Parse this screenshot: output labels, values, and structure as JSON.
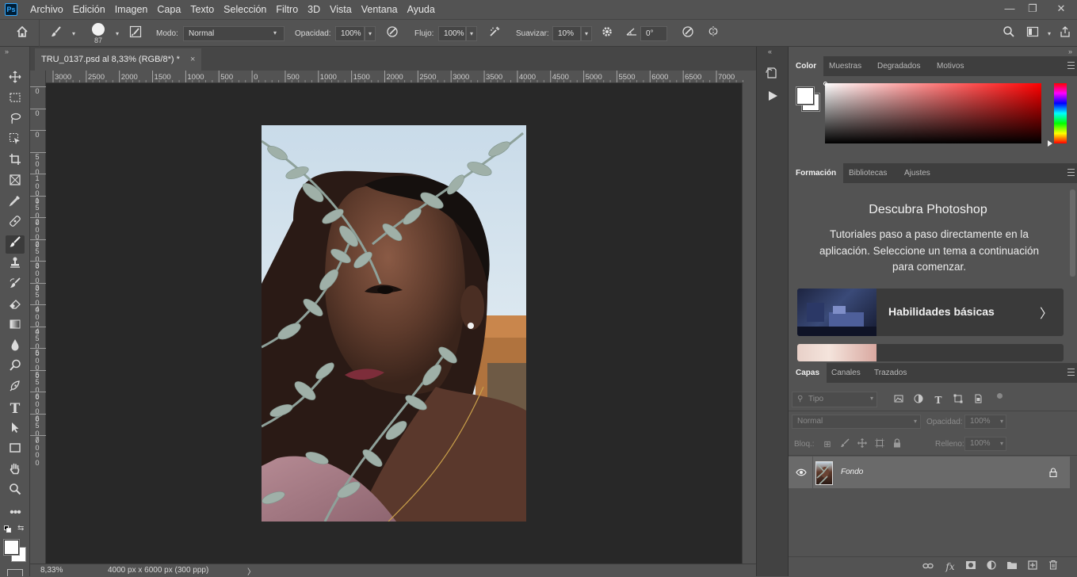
{
  "app": {
    "logo": "Ps"
  },
  "menubar": {
    "items": [
      "Archivo",
      "Edición",
      "Imagen",
      "Capa",
      "Texto",
      "Selección",
      "Filtro",
      "3D",
      "Vista",
      "Ventana",
      "Ayuda"
    ]
  },
  "window_controls": {
    "minimize": "—",
    "restore": "❐",
    "close": "✕"
  },
  "options": {
    "brush_size": "87",
    "mode_label": "Modo:",
    "mode_value": "Normal",
    "opacity_label": "Opacidad:",
    "opacity_value": "100%",
    "flow_label": "Flujo:",
    "flow_value": "100%",
    "smooth_label": "Suavizar:",
    "smooth_value": "10%",
    "angle_value": "0°"
  },
  "document": {
    "tab_title": "TRU_0137.psd al 8,33% (RGB/8*) *",
    "tab_close": "×",
    "zoom": "8,33%",
    "dimensions": "4000 px x 6000 px (300 ppp)",
    "status_arrow": "〉"
  },
  "rulers": {
    "horizontal": [
      "3000",
      "2500",
      "2000",
      "1500",
      "1000",
      "500",
      "0",
      "500",
      "1000",
      "1500",
      "2000",
      "2500",
      "3000",
      "3500",
      "4000",
      "4500",
      "5000",
      "5500",
      "6000",
      "6500",
      "7000"
    ],
    "vertical": [
      "0",
      "0",
      "0",
      "500",
      "1000",
      "1500",
      "2000",
      "2500",
      "3000",
      "3500",
      "4000",
      "4500",
      "5000",
      "5500",
      "6000",
      "6500",
      "7000"
    ]
  },
  "color_panel": {
    "tabs": [
      "Color",
      "Muestras",
      "Degradados",
      "Motivos"
    ],
    "active_tab": 0,
    "hue_color": "#ff0000"
  },
  "learn_panel": {
    "tabs": [
      "Formación",
      "Bibliotecas",
      "Ajustes"
    ],
    "active_tab": 0,
    "title": "Descubra Photoshop",
    "description": "Tutoriales paso a paso directamente en la aplicación. Seleccione un tema a continuación para comenzar.",
    "cards": [
      {
        "label": "Habilidades básicas",
        "arrow": "〉"
      },
      {
        "label": ""
      }
    ]
  },
  "layers_panel": {
    "tabs": [
      "Capas",
      "Canales",
      "Trazados"
    ],
    "active_tab": 0,
    "filter_placeholder": "Tipo",
    "blend_mode": "Normal",
    "opacity_label": "Opacidad:",
    "opacity_value": "100%",
    "lock_label": "Bloq.:",
    "fill_label": "Relleno:",
    "fill_value": "100%",
    "layers": [
      {
        "name": "Fondo",
        "visible": true,
        "locked": true
      }
    ]
  }
}
